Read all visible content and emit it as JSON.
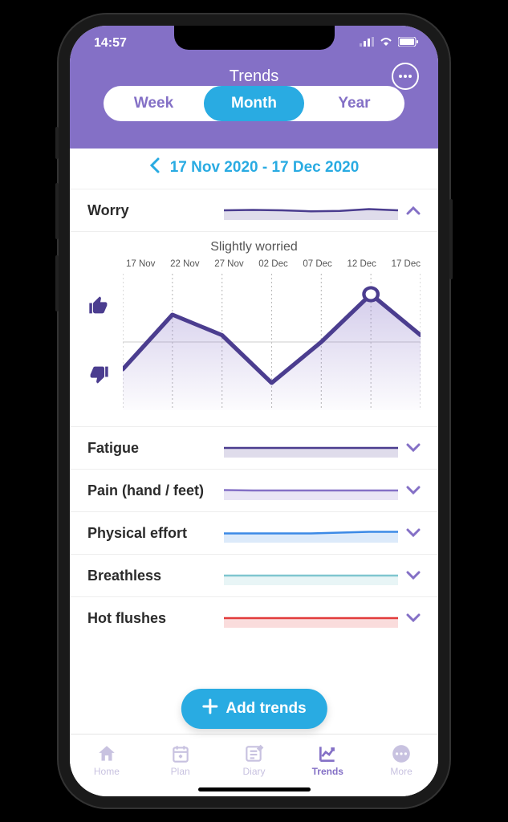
{
  "status_bar": {
    "time": "14:57"
  },
  "header": {
    "title": "Trends"
  },
  "segmented": {
    "week": "Week",
    "month": "Month",
    "year": "Year",
    "active": "Month"
  },
  "date_range": "17 Nov 2020 - 17 Dec 2020",
  "expanded": {
    "label": "Worry",
    "status": "Slightly worried",
    "xticks": [
      "17 Nov",
      "22 Nov",
      "27 Nov",
      "02 Dec",
      "07 Dec",
      "12 Dec",
      "17 Dec"
    ]
  },
  "trends": [
    {
      "label": "Fatigue"
    },
    {
      "label": "Pain (hand / feet)"
    },
    {
      "label": "Physical effort"
    },
    {
      "label": "Breathless"
    },
    {
      "label": "Hot flushes"
    }
  ],
  "fab": "Add trends",
  "tabs": {
    "home": "Home",
    "plan": "Plan",
    "diary": "Diary",
    "trends": "Trends",
    "more": "More"
  },
  "chart_data": {
    "type": "line",
    "title": "Worry",
    "ylabel": "Rating (thumbs-up high / thumbs-down low)",
    "ylim": [
      0,
      10
    ],
    "categories": [
      "17 Nov",
      "22 Nov",
      "27 Nov",
      "02 Dec",
      "07 Dec",
      "12 Dec",
      "17 Dec"
    ],
    "values": [
      3.0,
      7.0,
      5.5,
      2.0,
      5.0,
      8.5,
      5.5
    ],
    "highlight_index": 5,
    "status_label": "Slightly worried"
  },
  "sparklines": {
    "worry": {
      "color": "#4b3d8f",
      "values": [
        5.0,
        5.2,
        5.0,
        4.5,
        4.7,
        5.6,
        5.0
      ]
    },
    "fatigue": {
      "color": "#4b3d8f",
      "values": [
        5.0,
        5.0,
        5.0,
        5.0,
        5.0,
        5.0,
        5.0
      ]
    },
    "pain": {
      "color": "#8470C6",
      "values": [
        5.2,
        5.0,
        5.0,
        5.0,
        5.0,
        5.0,
        5.0
      ]
    },
    "physical_effort": {
      "color": "#3c8ae6",
      "values": [
        4.8,
        4.8,
        4.8,
        4.8,
        5.2,
        5.6,
        5.6
      ]
    },
    "breathless": {
      "color": "#7fc6cf",
      "values": [
        5.0,
        5.0,
        5.0,
        5.0,
        5.0,
        5.0,
        5.0
      ]
    },
    "hot_flushes": {
      "color": "#e23c3c",
      "values": [
        5.0,
        5.0,
        5.0,
        5.0,
        5.0,
        5.0,
        5.0
      ]
    }
  }
}
